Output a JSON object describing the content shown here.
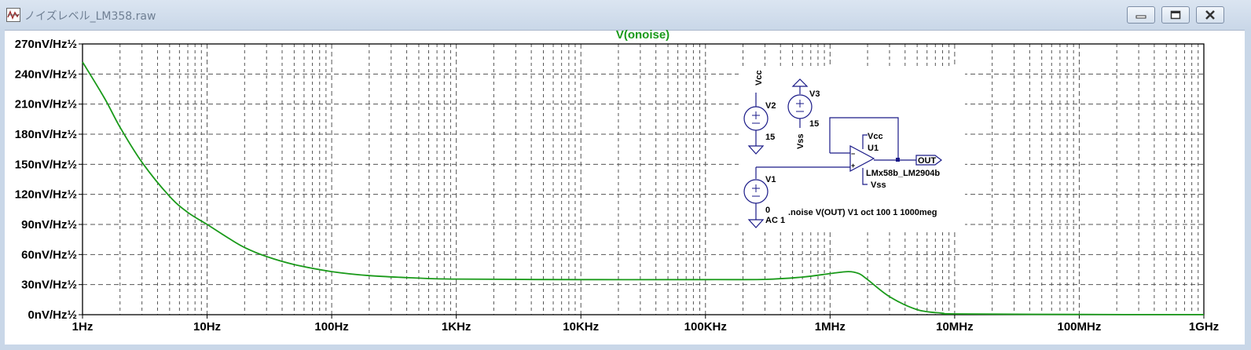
{
  "window": {
    "title": "ノイズレベル_LM358.raw",
    "buttons": {
      "minimize": "minimize-icon",
      "maximize": "maximize-icon",
      "close": "close-icon"
    }
  },
  "chart_data": {
    "type": "line",
    "title": "V(onoise)",
    "xscale": "log",
    "xlim": [
      1,
      1000000000
    ],
    "ylim": [
      0,
      270
    ],
    "x_ticks": [
      {
        "value": 1,
        "label": "1Hz"
      },
      {
        "value": 10,
        "label": "10Hz"
      },
      {
        "value": 100,
        "label": "100Hz"
      },
      {
        "value": 1000,
        "label": "1KHz"
      },
      {
        "value": 10000,
        "label": "10KHz"
      },
      {
        "value": 100000,
        "label": "100KHz"
      },
      {
        "value": 1000000,
        "label": "1MHz"
      },
      {
        "value": 10000000,
        "label": "10MHz"
      },
      {
        "value": 100000000,
        "label": "100MHz"
      },
      {
        "value": 1000000000,
        "label": "1GHz"
      }
    ],
    "y_ticks": [
      {
        "value": 0,
        "label": "0nV/Hz½"
      },
      {
        "value": 30,
        "label": "30nV/Hz½"
      },
      {
        "value": 60,
        "label": "60nV/Hz½"
      },
      {
        "value": 90,
        "label": "90nV/Hz½"
      },
      {
        "value": 120,
        "label": "120nV/Hz½"
      },
      {
        "value": 150,
        "label": "150nV/Hz½"
      },
      {
        "value": 180,
        "label": "180nV/Hz½"
      },
      {
        "value": 210,
        "label": "210nV/Hz½"
      },
      {
        "value": 240,
        "label": "240nV/Hz½"
      },
      {
        "value": 270,
        "label": "270nV/Hz½"
      }
    ],
    "grid": true,
    "series": [
      {
        "name": "V(onoise)",
        "color": "#1a9a1a",
        "points": [
          [
            1,
            252
          ],
          [
            1.5,
            216
          ],
          [
            2,
            187
          ],
          [
            3,
            152
          ],
          [
            5,
            118
          ],
          [
            7,
            102
          ],
          [
            10,
            90
          ],
          [
            15,
            76
          ],
          [
            20,
            67
          ],
          [
            30,
            58
          ],
          [
            50,
            50
          ],
          [
            100,
            43
          ],
          [
            200,
            39
          ],
          [
            500,
            36.5
          ],
          [
            1000,
            35.5
          ],
          [
            10000,
            35
          ],
          [
            100000,
            35
          ],
          [
            300000,
            35.2
          ],
          [
            600000,
            37.5
          ],
          [
            1000000,
            41
          ],
          [
            1400000,
            43
          ],
          [
            1700000,
            41
          ],
          [
            2000000,
            35
          ],
          [
            3000000,
            18
          ],
          [
            5000000,
            5
          ],
          [
            8000000,
            1.5
          ],
          [
            10000000,
            0.8
          ],
          [
            100000000,
            0.2
          ],
          [
            1000000000,
            0.1
          ]
        ]
      }
    ]
  },
  "schematic": {
    "v2": {
      "name": "V2",
      "value": "15",
      "net": "Vcc"
    },
    "v3": {
      "name": "V3",
      "value": "15",
      "net": "Vss"
    },
    "v1": {
      "name": "V1",
      "value": "0",
      "ac": "AC 1"
    },
    "u1": {
      "name": "U1",
      "model": "LMx58b_LM2904b",
      "vcc": "Vcc",
      "vss": "Vss"
    },
    "out_label": "OUT",
    "directive": ".noise V(OUT) V1 oct 100 1 1000meg"
  }
}
